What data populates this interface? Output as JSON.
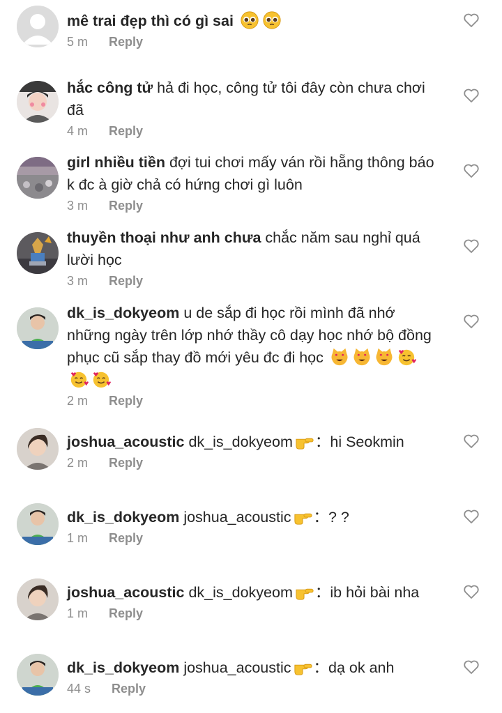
{
  "colors": {
    "text": "#262626",
    "meta": "#8e8e8e",
    "heart_outline": "#8e8e8e"
  },
  "comments": [
    {
      "username": "mê trai đẹp thì có gì sai",
      "text": "",
      "emojis": [
        "pleading-face",
        "pleading-face"
      ],
      "time": "5 m",
      "reply_label": "Reply",
      "avatar": "default-avatar"
    },
    {
      "username": "hắc công tử",
      "text": "hả đi học,  công tử tôi đây còn chưa chơi đã",
      "emojis": [],
      "time": "4 m",
      "reply_label": "Reply",
      "avatar": "photo-avatar"
    },
    {
      "username": "girl nhiều tiền",
      "text": "đợi tui chơi mấy ván rồi hẵng thông báo k đc à giờ chả có hứng chơi gì luôn",
      "emojis": [],
      "time": "3 m",
      "reply_label": "Reply",
      "avatar": "photo-avatar"
    },
    {
      "username": "thuyền thoại như anh chưa",
      "text": "chắc năm sau nghỉ quá lười học",
      "emojis": [],
      "time": "3 m",
      "reply_label": "Reply",
      "avatar": "photo-avatar"
    },
    {
      "username": "dk_is_dokyeom",
      "text": "u de sắp đi học rồi mình đã nhớ những ngày trên lớp nhớ thầy cô dạy học nhớ bộ đồng phục cũ sắp thay đồ mới yêu đc đi học",
      "emojis": [
        "heart-eyes-cat",
        "heart-eyes-cat",
        "heart-eyes-cat",
        "smiling-face-with-hearts",
        "smiling-face-with-hearts",
        "smiling-face-with-hearts"
      ],
      "time": "2 m",
      "reply_label": "Reply",
      "avatar": "photo-avatar"
    },
    {
      "username": "joshua_acoustic",
      "text_before": "dk_is_dokyeom",
      "emoji_mid": "pointing-right",
      "text_after": "：hi Seokmin",
      "time": "2 m",
      "reply_label": "Reply",
      "avatar": "photo-avatar"
    },
    {
      "username": "dk_is_dokyeom",
      "text_before": "joshua_acoustic",
      "emoji_mid": "pointing-right",
      "text_after": "：? ?",
      "time": "1 m",
      "reply_label": "Reply",
      "avatar": "photo-avatar"
    },
    {
      "username": "joshua_acoustic",
      "text_before": "dk_is_dokyeom",
      "emoji_mid": "pointing-right",
      "text_after": "：ib hỏi bài nha",
      "time": "1 m",
      "reply_label": "Reply",
      "avatar": "photo-avatar"
    },
    {
      "username": "dk_is_dokyeom",
      "text_before": "joshua_acoustic",
      "emoji_mid": "pointing-right",
      "text_after": "：dạ ok anh",
      "time": "44 s",
      "reply_label": "Reply",
      "avatar": "photo-avatar"
    }
  ]
}
